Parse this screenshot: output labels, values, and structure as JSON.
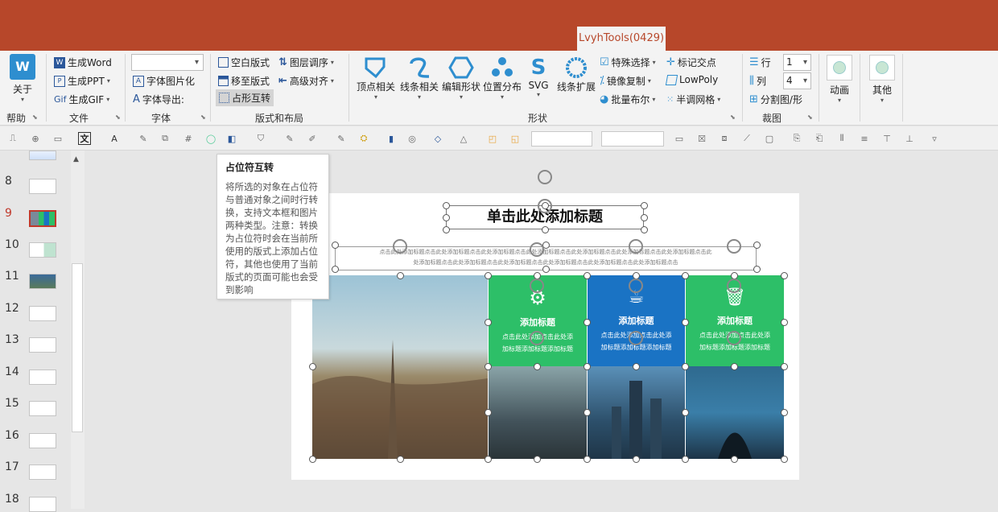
{
  "app": {
    "tab_label": "LvyhTools(0429)"
  },
  "ribbon": {
    "help": {
      "button": "关于",
      "group": "帮助"
    },
    "file": {
      "items": [
        "生成Word",
        "生成PPT",
        "生成GIF"
      ],
      "group": "文件"
    },
    "font": {
      "items": [
        "字体图片化",
        "字体导出:"
      ],
      "group": "字体"
    },
    "layout": {
      "items": [
        "空白版式",
        "移至版式",
        "占形互转",
        "图层调序",
        "高级对齐"
      ],
      "group": "版式和布局"
    },
    "shape": {
      "buttons": [
        "顶点相关",
        "线条相关",
        "编辑形状",
        "位置分布",
        "SVG",
        "线条扩展"
      ],
      "small_items": [
        "特殊选择",
        "镜像复制",
        "批量布尔",
        "标记交点",
        "LowPoly",
        "半调网格"
      ],
      "group": "形状"
    },
    "crop": {
      "items": [
        "行",
        "列",
        "分割图/形"
      ],
      "row_value": "1",
      "col_value": "4",
      "group": "裁图"
    },
    "animation": {
      "button": "动画"
    },
    "other": {
      "button": "其他"
    }
  },
  "tooltip": {
    "title": "占位符互转",
    "body": "将所选的对象在占位符与普通对象之间时行转换，支持文本框和图片两种类型。注意：转换为占位符时会在当前所使用的版式上添加占位符，其他也使用了当前版式的页面可能也会受到影响"
  },
  "slides_panel": {
    "numbers": [
      "8",
      "9",
      "10",
      "11",
      "12",
      "13",
      "14",
      "15",
      "16",
      "17",
      "18"
    ],
    "active": "9"
  },
  "slide": {
    "title": "单击此处添加标题",
    "subtitle_line1": "点击此处添加标题点击此处添加标题点击此处添加标题点击此处添加标题点击此处添加标题点击此处添加标题点击此处添加标题点击此",
    "subtitle_line2": "处添加标题点击此处添加标题点击此处添加标题点击此处添加标题点击此处添加标题点击此处添加标题点击",
    "cards": [
      {
        "title": "添加标题",
        "text1": "点击此处添加点击此处添",
        "text2": "加标题添加标题添加标题",
        "icon": "gear-icon",
        "color": "#2dbf68"
      },
      {
        "title": "添加标题",
        "text1": "点击此处添加点击此处添",
        "text2": "加标题添加标题添加标题",
        "icon": "cup-icon",
        "color": "#1a73c4"
      },
      {
        "title": "添加标题",
        "text1": "点击此处添加点击此处添",
        "text2": "加标题添加标题添加标题",
        "icon": "trash-icon",
        "color": "#2dbf68"
      }
    ]
  },
  "colors": {
    "titlebar": "#b7472a",
    "green": "#2dbf68",
    "blue": "#1a73c4",
    "active_slide": "#c0392b"
  }
}
